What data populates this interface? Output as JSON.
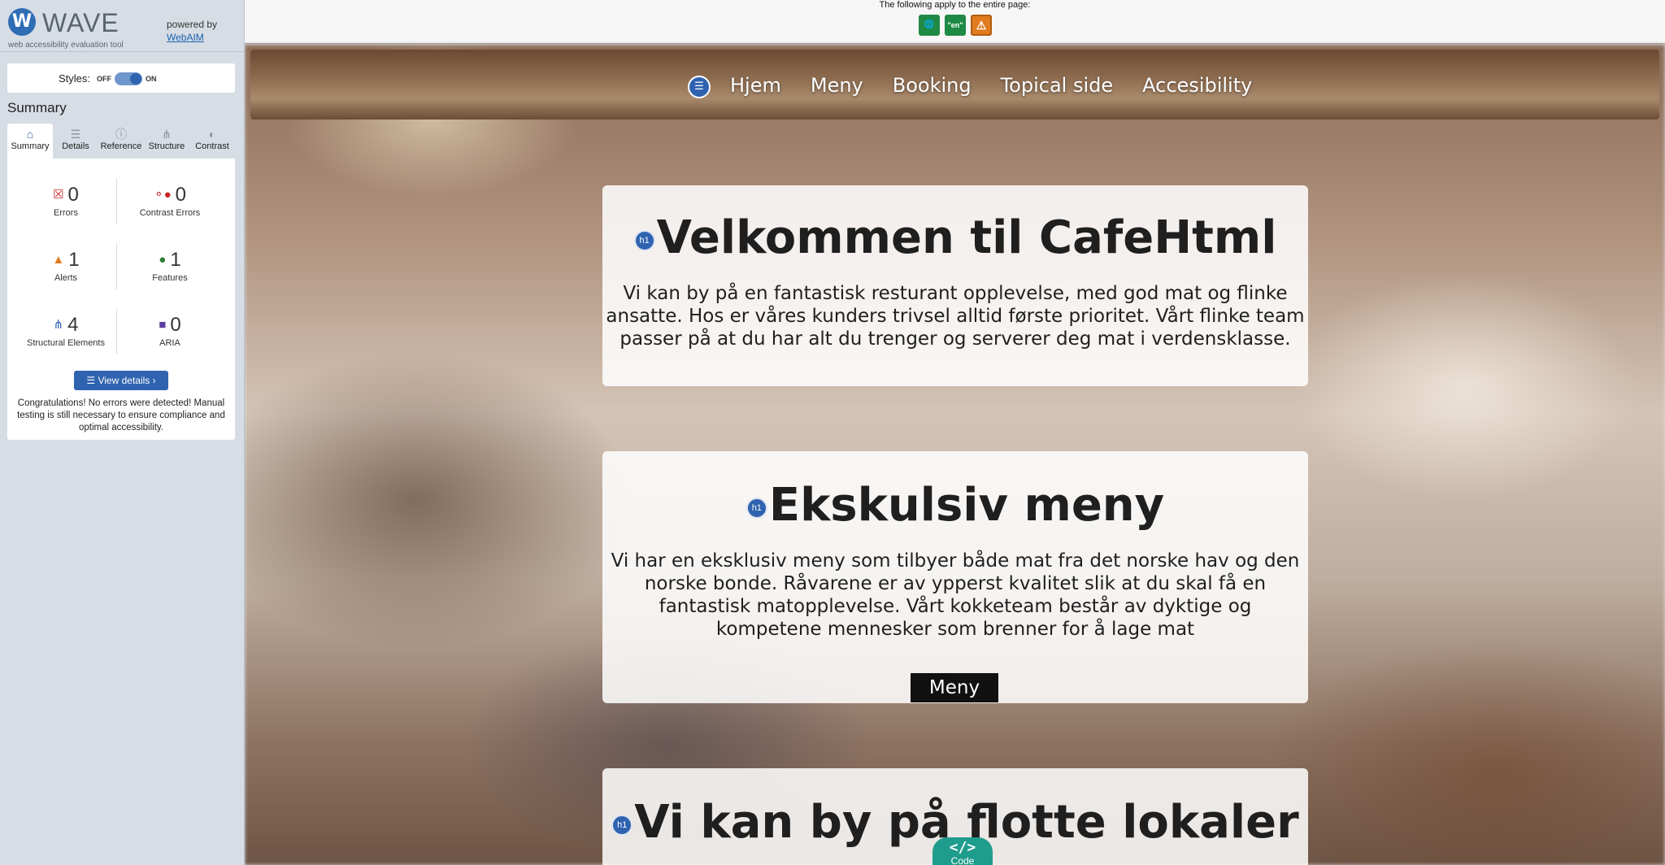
{
  "wave": {
    "logo_letter": "W",
    "name": "WAVE",
    "subtitle": "web accessibility evaluation tool",
    "powered_by": "powered by",
    "webaim_link": "WebAIM",
    "styles_label": "Styles:",
    "styles_off": "OFF",
    "styles_on": "ON",
    "summary_title": "Summary",
    "tabs": [
      {
        "label": "Summary",
        "icon": "home-icon",
        "glyph": "⌂"
      },
      {
        "label": "Details",
        "icon": "list-icon",
        "glyph": "☰"
      },
      {
        "label": "Reference",
        "icon": "info-icon",
        "glyph": "ⓘ"
      },
      {
        "label": "Structure",
        "icon": "structure-icon",
        "glyph": "⋔"
      },
      {
        "label": "Contrast",
        "icon": "contrast-icon",
        "glyph": "◐"
      }
    ],
    "stats": {
      "errors": {
        "count": "0",
        "label": "Errors"
      },
      "contrast_errors": {
        "count": "0",
        "label": "Contrast Errors"
      },
      "alerts": {
        "count": "1",
        "label": "Alerts"
      },
      "features": {
        "count": "1",
        "label": "Features"
      },
      "structural": {
        "count": "4",
        "label": "Structural Elements"
      },
      "aria": {
        "count": "0",
        "label": "ARIA"
      }
    },
    "view_details": "View details ›",
    "congrats": "Congratulations! No errors were detected! Manual testing is still necessary to ensure compliance and optimal accessibility."
  },
  "topbar": {
    "text": "The following apply to the entire page:",
    "icons": [
      {
        "name": "language-icon",
        "glyph": "🌐"
      },
      {
        "name": "lang-en-icon",
        "glyph": "\"en\""
      },
      {
        "name": "alert-icon",
        "glyph": "⚠"
      }
    ]
  },
  "nav": {
    "items": [
      "Hjem",
      "Meny",
      "Booking",
      "Topical side",
      "Accesibility"
    ]
  },
  "cards": [
    {
      "badge": "h1",
      "title": "Velkommen til CafeHtml",
      "text": "Vi kan by på en fantastisk resturant opplevelse, med god mat og flinke ansatte. Hos er våres kunders trivsel alltid første prioritet. Vårt flinke team passer på at du har alt du trenger og serverer deg mat i verdensklasse."
    },
    {
      "badge": "h1",
      "title": "Ekskulsiv meny",
      "text": "Vi har en eksklusiv meny som tilbyer både mat fra det norske hav og den norske bonde. Råvarene er av ypperst kvalitet slik at du skal få en fantastisk matopplevelse. Vårt kokketeam består av dyktige og kompetene mennesker som brenner for å lage mat",
      "button": "Meny"
    },
    {
      "badge": "h1",
      "title": "Vi kan by på flotte lokaler"
    }
  ],
  "code_button": {
    "glyph": "</>",
    "label": "Code"
  },
  "colors": {
    "wave_blue": "#2f63b0",
    "error_red": "#c62828",
    "alert_orange": "#e07b20",
    "feature_green": "#2e7d32",
    "code_teal": "#1e9c8c"
  }
}
